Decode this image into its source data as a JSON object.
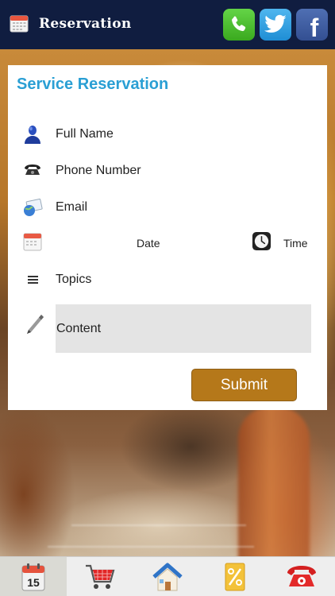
{
  "header": {
    "title": "Reservation",
    "icons": [
      "calendar-icon",
      "phone-icon",
      "twitter-icon",
      "facebook-icon"
    ],
    "facebook_glyph": "f",
    "background_color": "#101d40"
  },
  "form": {
    "title": "Service Reservation",
    "fields": {
      "full_name": "Full Name",
      "phone_number": "Phone Number",
      "email": "Email",
      "date": "Date",
      "time": "Time",
      "topics": "Topics",
      "content": "Content"
    },
    "submit_label": "Submit",
    "accent_color": "#2a9fd4",
    "submit_color": "#b5781a"
  },
  "tabbar": {
    "tabs": [
      "calendar-tab-icon",
      "shopping-cart-icon",
      "home-icon",
      "coupon-icon",
      "telephone-icon"
    ],
    "calendar_day": "15",
    "active_tab": "calendar-tab-icon"
  }
}
